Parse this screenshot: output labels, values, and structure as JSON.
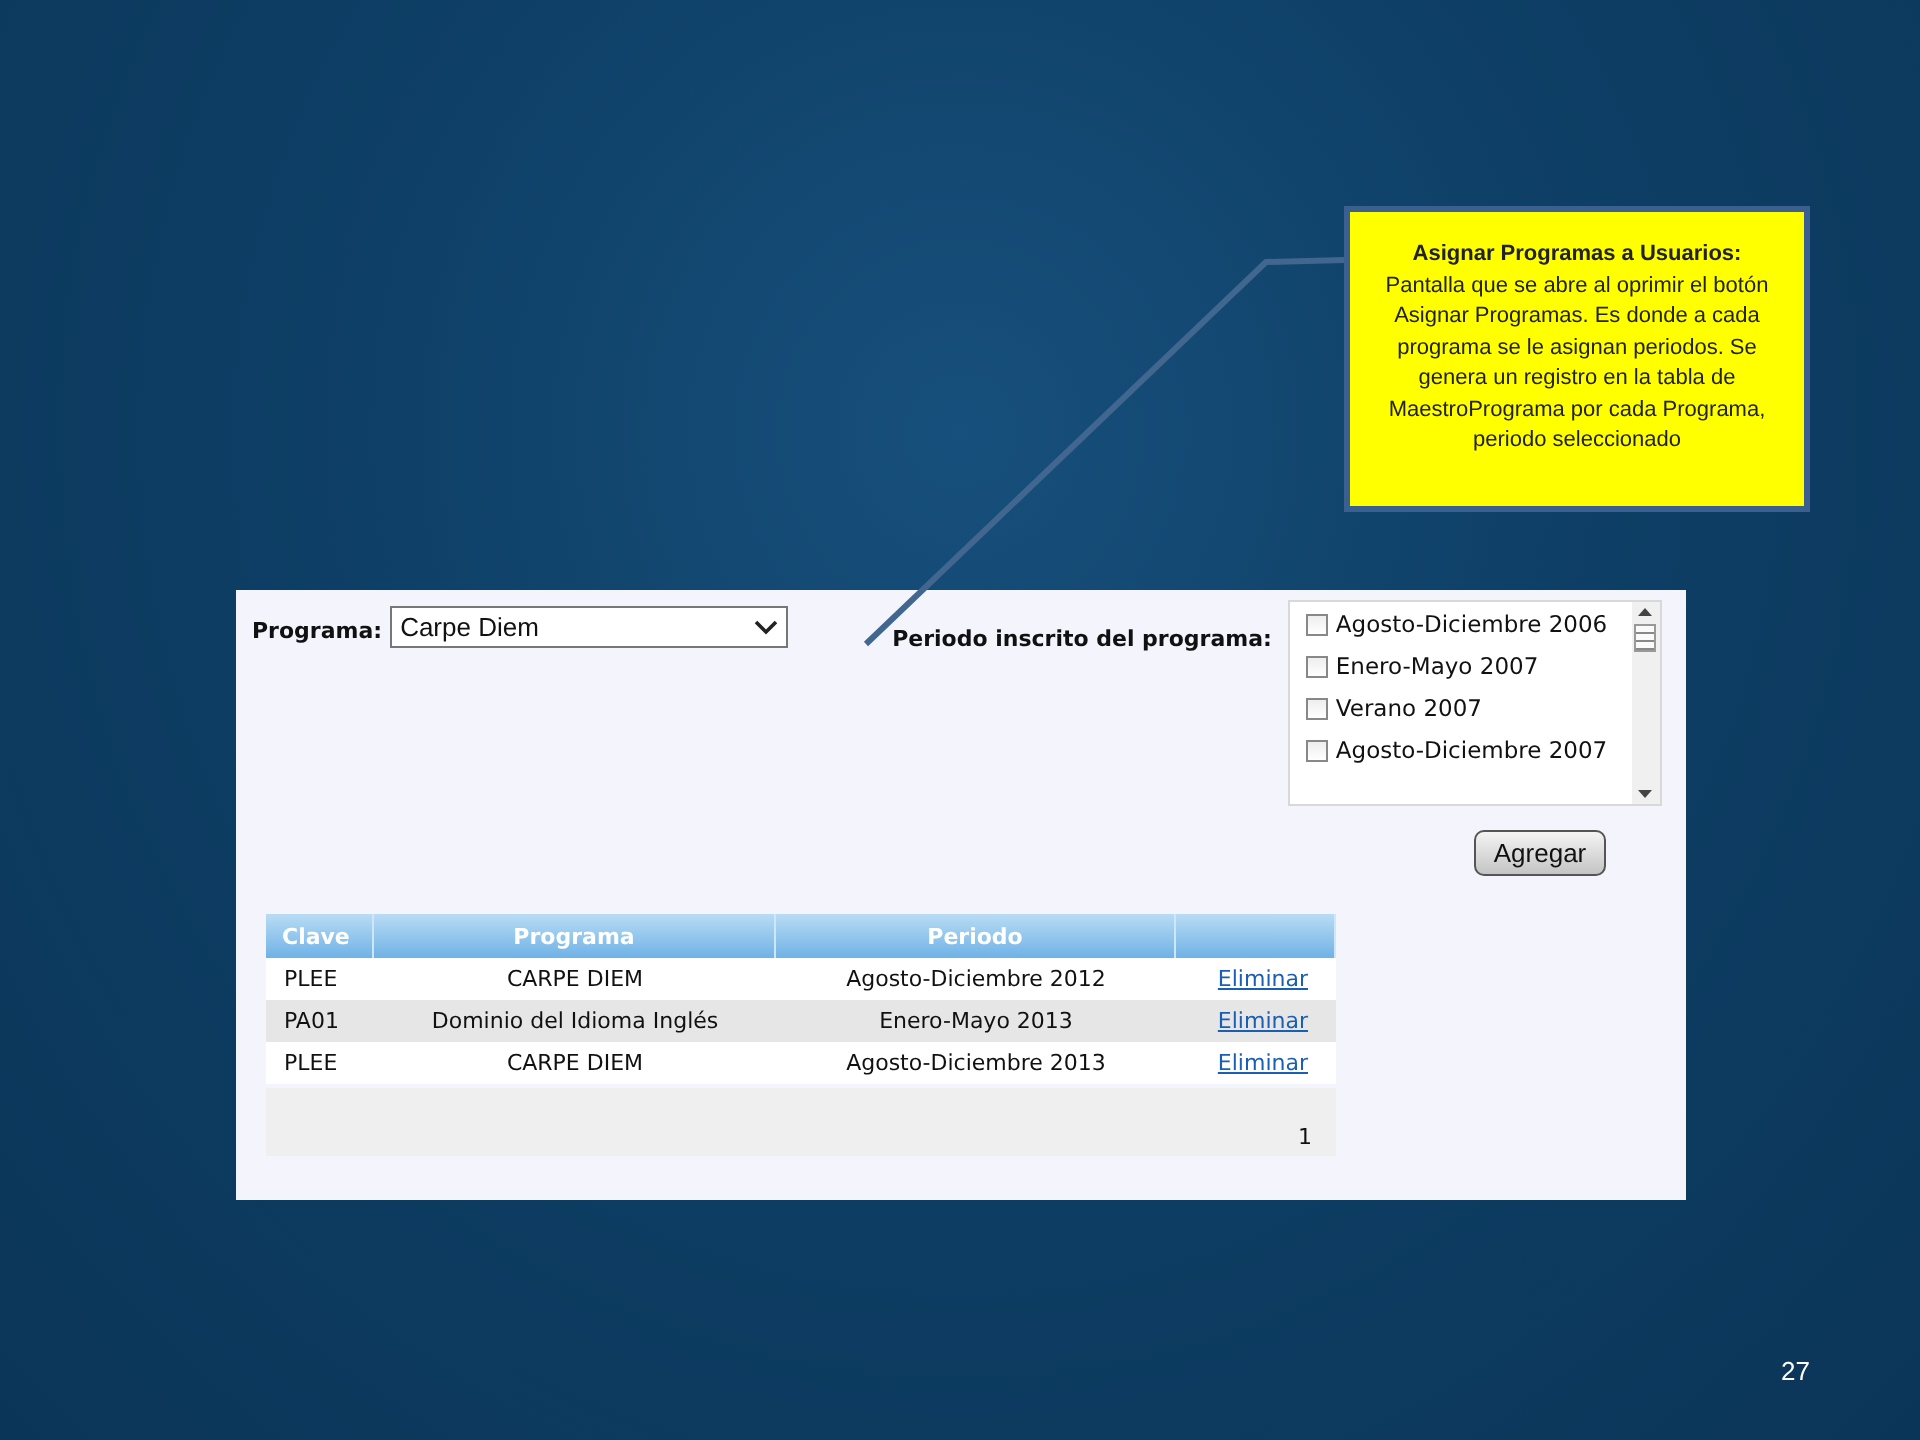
{
  "callout": {
    "title": "Asignar Programas a Usuarios:",
    "body": "Pantalla que se abre al oprimir el botón Asignar Programas. Es donde a cada programa se le asignan periodos. Se genera un registro en la tabla de MaestroPrograma por cada Programa, periodo seleccionado"
  },
  "form": {
    "program_label": "Programa:",
    "program_select": {
      "value": "Carpe Diem"
    },
    "period_label": "Periodo inscrito del programa:",
    "periods": [
      {
        "label": "Agosto-Diciembre 2006",
        "checked": false
      },
      {
        "label": "Enero-Mayo 2007",
        "checked": false
      },
      {
        "label": "Verano 2007",
        "checked": false
      },
      {
        "label": "Agosto-Diciembre 2007",
        "checked": false
      }
    ],
    "add_button": "Agregar"
  },
  "table": {
    "columns": [
      "Clave",
      "Programa",
      "Periodo"
    ],
    "rows": [
      {
        "clave": "PLEE",
        "programa": "CARPE DIEM",
        "periodo": "Agosto-Diciembre 2012",
        "action": "Eliminar"
      },
      {
        "clave": "PA01",
        "programa": "Dominio del Idioma Inglés",
        "periodo": "Enero-Mayo 2013",
        "action": "Eliminar"
      },
      {
        "clave": "PLEE",
        "programa": "CARPE DIEM",
        "periodo": "Agosto-Diciembre 2013",
        "action": "Eliminar"
      }
    ],
    "pager": "1"
  },
  "slide_number": "27"
}
